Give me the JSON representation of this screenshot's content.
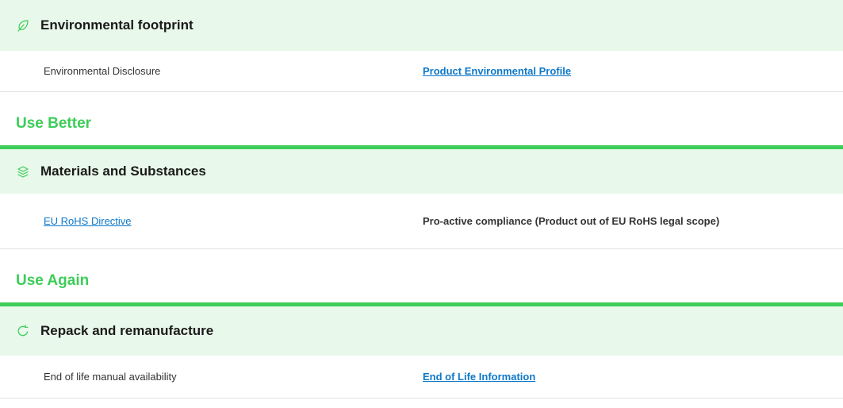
{
  "colors": {
    "accent_green": "#3dcd58",
    "header_band": "#e8f8ea",
    "link_blue": "#0e78c8"
  },
  "sections": [
    {
      "title": "",
      "category": {
        "icon": "leaf-icon",
        "label": "Environmental footprint"
      },
      "row": {
        "name": "Environmental Disclosure",
        "value": "Product Environmental Profile"
      }
    },
    {
      "title": "Use Better",
      "category": {
        "icon": "layers-icon",
        "label": "Materials and Substances"
      },
      "row": {
        "name": "EU RoHS Directive",
        "value": "Pro-active compliance (Product out of EU RoHS legal scope)"
      }
    },
    {
      "title": "Use Again",
      "category": {
        "icon": "recycle-icon",
        "label": "Repack and remanufacture"
      },
      "row": {
        "name": "End of life manual availability",
        "value": "End of Life Information"
      }
    }
  ]
}
